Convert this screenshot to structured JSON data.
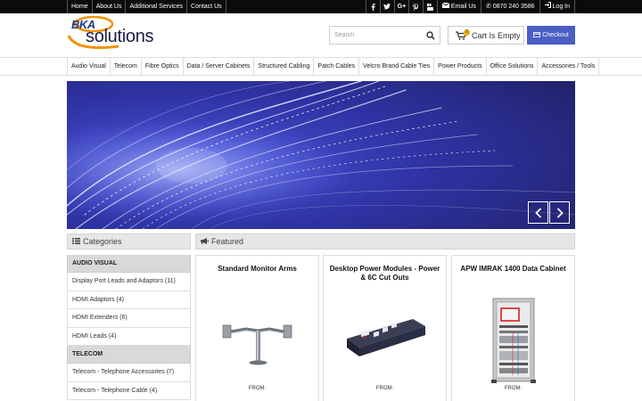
{
  "topbar": {
    "links": [
      "Home",
      "About Us",
      "Additional Services",
      "Contact Us"
    ],
    "social_icons": [
      "facebook-icon",
      "twitter-icon",
      "google-plus-icon",
      "pinterest-icon",
      "youtube-icon"
    ],
    "email_label": "Email Us",
    "phone_label": "0870 240 3586",
    "login_label": "Log In"
  },
  "header": {
    "logo_top": "BKA",
    "logo_bottom": "solutions",
    "search_placeholder": "Search",
    "cart_label": "Cart Is Empty",
    "cart_count": "0",
    "checkout_label": "Checkout"
  },
  "nav": {
    "items": [
      "Audio Visual",
      "Telecom",
      "Fibre Optics",
      "Data / Server Cabinets",
      "Structured Cabling",
      "Patch Cables",
      "Velcro Brand Cable Ties",
      "Power Products",
      "Office Solutions",
      "Accessories / Tools"
    ]
  },
  "hero": {
    "prev_icon": "chevron-left-icon",
    "next_icon": "chevron-right-icon"
  },
  "categories": {
    "title": "Categories",
    "groups": [
      {
        "heading": "AUDIO VISUAL",
        "items": [
          "Display Port Leads and Adaptors (11)",
          "HDMI Adaptors (4)",
          "HDMI Extenders (6)",
          "HDMI Leads (4)"
        ]
      },
      {
        "heading": "TELECOM",
        "items": [
          "Telecom - Telephone Accessories (7)",
          "Telecom - Telephone Cable (4)"
        ]
      }
    ]
  },
  "featured": {
    "title": "Featured",
    "products": [
      {
        "name": "Standard Monitor Arms",
        "from": "FROM:"
      },
      {
        "name": "Desktop Power Modules - Power & 6C Cut Outs",
        "from": "FROM:"
      },
      {
        "name": "APW IMRAK 1400 Data Cabinet",
        "from": "FROM:"
      }
    ]
  },
  "colors": {
    "topbar_bg": "#0b0b0b",
    "checkout_bg": "#4a5ec4",
    "hero_bg": "#2a2c8c",
    "cart_badge": "#f2b400"
  }
}
